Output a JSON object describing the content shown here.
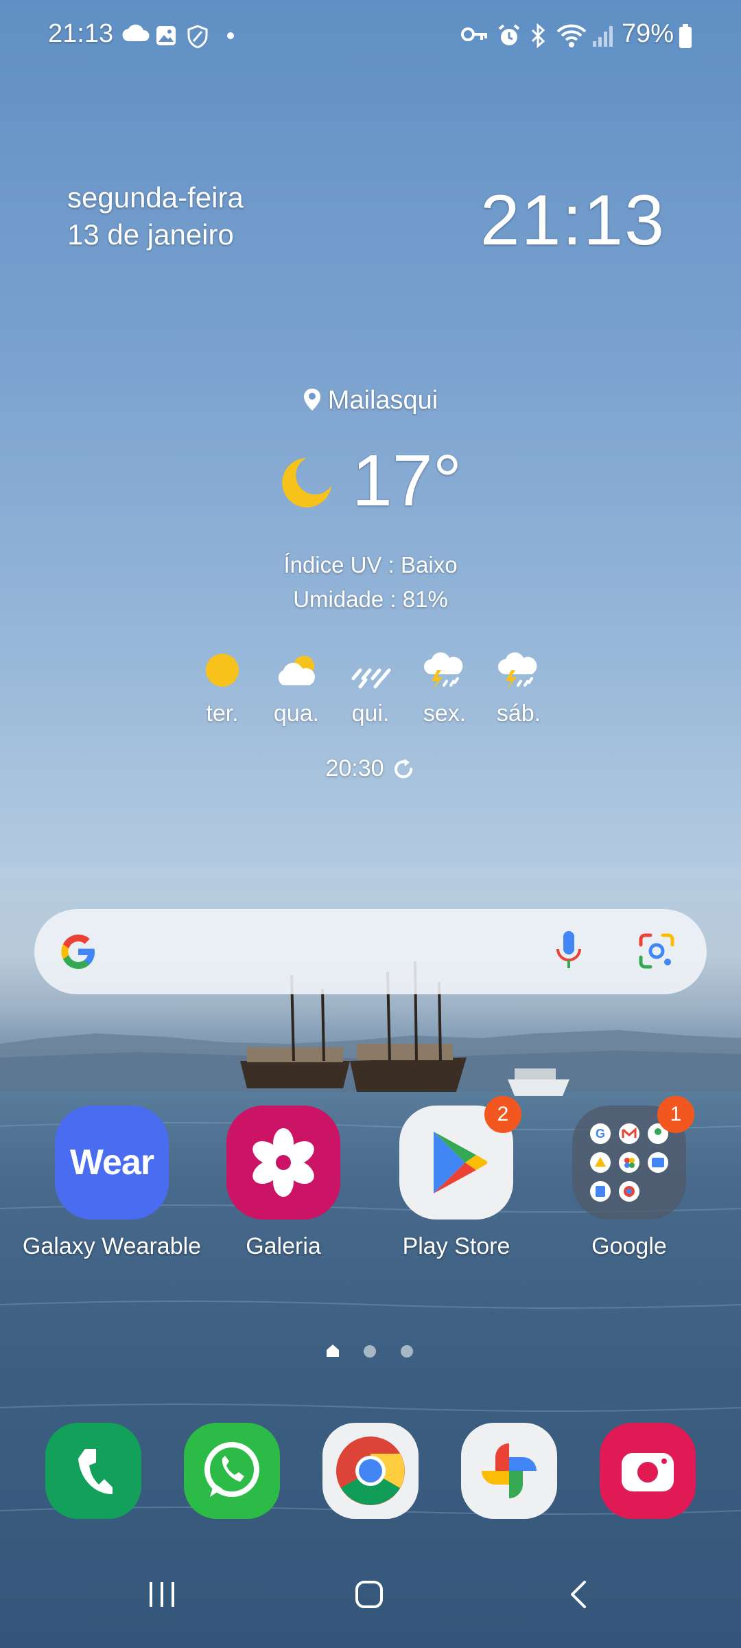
{
  "status_bar": {
    "time": "21:13",
    "battery": "79%",
    "icons_left": [
      "cloud-icon",
      "gallery-icon",
      "shield-icon",
      "dot-icon"
    ],
    "icons_right": [
      "key-icon",
      "alarm-icon",
      "bluetooth-icon",
      "wifi-icon",
      "signal-icon",
      "battery-icon"
    ]
  },
  "clock_widget": {
    "day": "segunda-feira",
    "date": "13 de janeiro",
    "time": "21:13"
  },
  "weather": {
    "location": "Mailasqui",
    "temperature": "17°",
    "condition_icon": "moon-icon",
    "uv": "Índice UV : Baixo",
    "humidity": "Umidade : 81%",
    "forecast": [
      {
        "day": "ter.",
        "icon": "sun-icon"
      },
      {
        "day": "qua.",
        "icon": "partly-cloudy-icon"
      },
      {
        "day": "qui.",
        "icon": "rain-icon"
      },
      {
        "day": "sex.",
        "icon": "thunderstorm-icon"
      },
      {
        "day": "sáb.",
        "icon": "thunderstorm-icon"
      }
    ],
    "updated": "20:30"
  },
  "search": {
    "icons": [
      "google-logo-icon",
      "microphone-icon",
      "lens-icon"
    ]
  },
  "apps": [
    {
      "label": "Galaxy Wearable",
      "icon_text": "Wear",
      "badge": ""
    },
    {
      "label": "Galeria",
      "badge": ""
    },
    {
      "label": "Play Store",
      "badge": "2"
    },
    {
      "label": "Google",
      "badge": "1"
    }
  ],
  "page_indicator": {
    "pages": 3,
    "current": 1
  },
  "dock": [
    {
      "name": "phone-icon"
    },
    {
      "name": "whatsapp-icon"
    },
    {
      "name": "chrome-icon"
    },
    {
      "name": "photos-icon"
    },
    {
      "name": "camera-icon"
    }
  ],
  "colors": {
    "sky": "#6f9acb",
    "sea": "#3d5f81",
    "badge": "#f2571f",
    "wear": "#4a6cf0",
    "galeria": "#cc1466",
    "phone": "#13a05a",
    "whatsapp": "#2dbb47",
    "camera": "#e01a55"
  }
}
